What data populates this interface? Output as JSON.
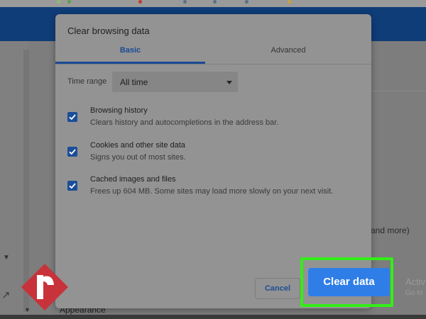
{
  "dialog": {
    "title": "Clear browsing data",
    "tabs": [
      {
        "label": "Basic",
        "active": true
      },
      {
        "label": "Advanced",
        "active": false
      }
    ],
    "time_range": {
      "label": "Time range",
      "value": "All time"
    },
    "options": [
      {
        "title": "Browsing history",
        "description": "Clears history and autocompletions in the address bar.",
        "checked": true
      },
      {
        "title": "Cookies and other site data",
        "description": "Signs you out of most sites.",
        "checked": true
      },
      {
        "title": "Cached images and files",
        "description": "Frees up 604 MB. Some sites may load more slowly on your next visit.",
        "checked": true
      }
    ],
    "buttons": {
      "cancel": "Cancel",
      "clear": "Clear data"
    }
  },
  "background": {
    "partial_text_right": "and more)",
    "appearance_label": "Appearance",
    "activate_windows_1": "Activ",
    "activate_windows_2": "Go to"
  },
  "colors": {
    "accent": "#1a4a93",
    "primary_button": "#2f7ee8",
    "highlight": "#33ee18",
    "header": "#0f3d78"
  },
  "icons": {
    "checkbox": "checkmark-icon",
    "dropdown": "caret-down-icon",
    "logo": "watermark-logo"
  }
}
